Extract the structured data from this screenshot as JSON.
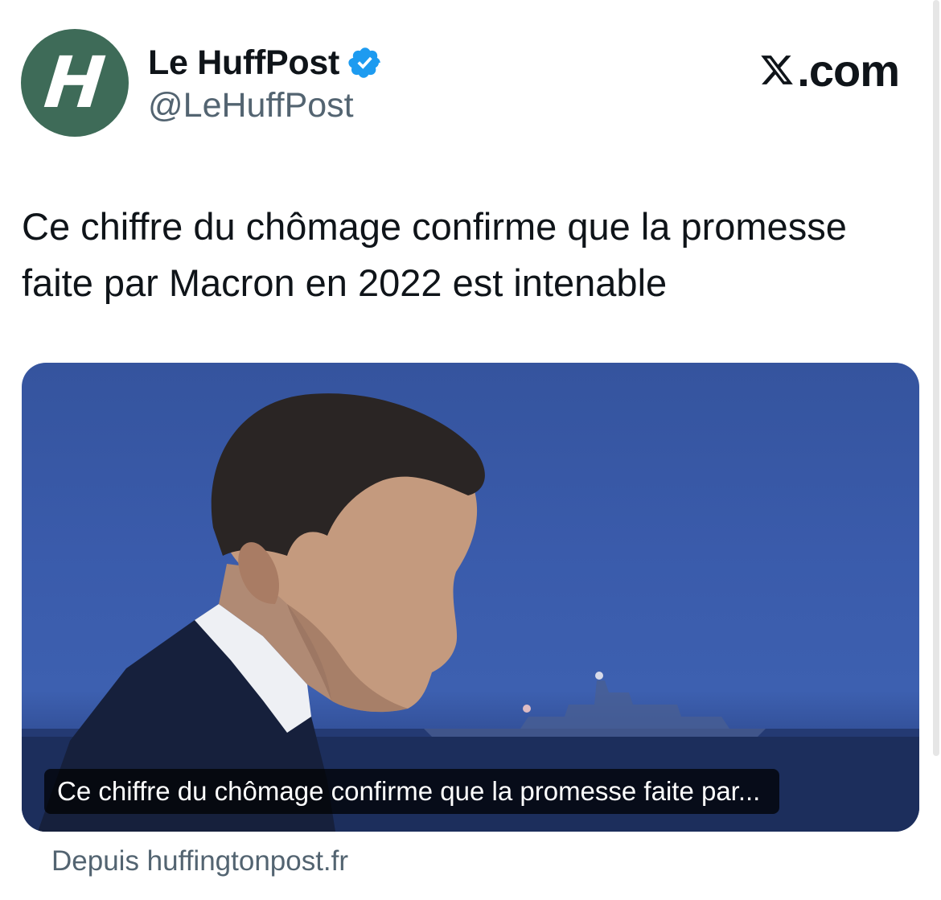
{
  "author": {
    "avatar_letter": "H",
    "display_name": "Le HuffPost",
    "handle": "@LeHuffPost",
    "verified_icon": "verified-badge-icon"
  },
  "brand": {
    "icon": "x-logo-icon",
    "text": ".com"
  },
  "tweet": {
    "text": "Ce chiffre du chômage confirme que la promesse\nfaite par Macron en 2022 est intenable"
  },
  "link_card": {
    "caption": "Ce chiffre du chômage confirme que la promesse faite par...",
    "source": "Depuis huffingtonpost.fr"
  },
  "colors": {
    "avatar_bg": "#3e6b58",
    "verified_blue": "#1d9bf0",
    "secondary_text": "#536471"
  }
}
